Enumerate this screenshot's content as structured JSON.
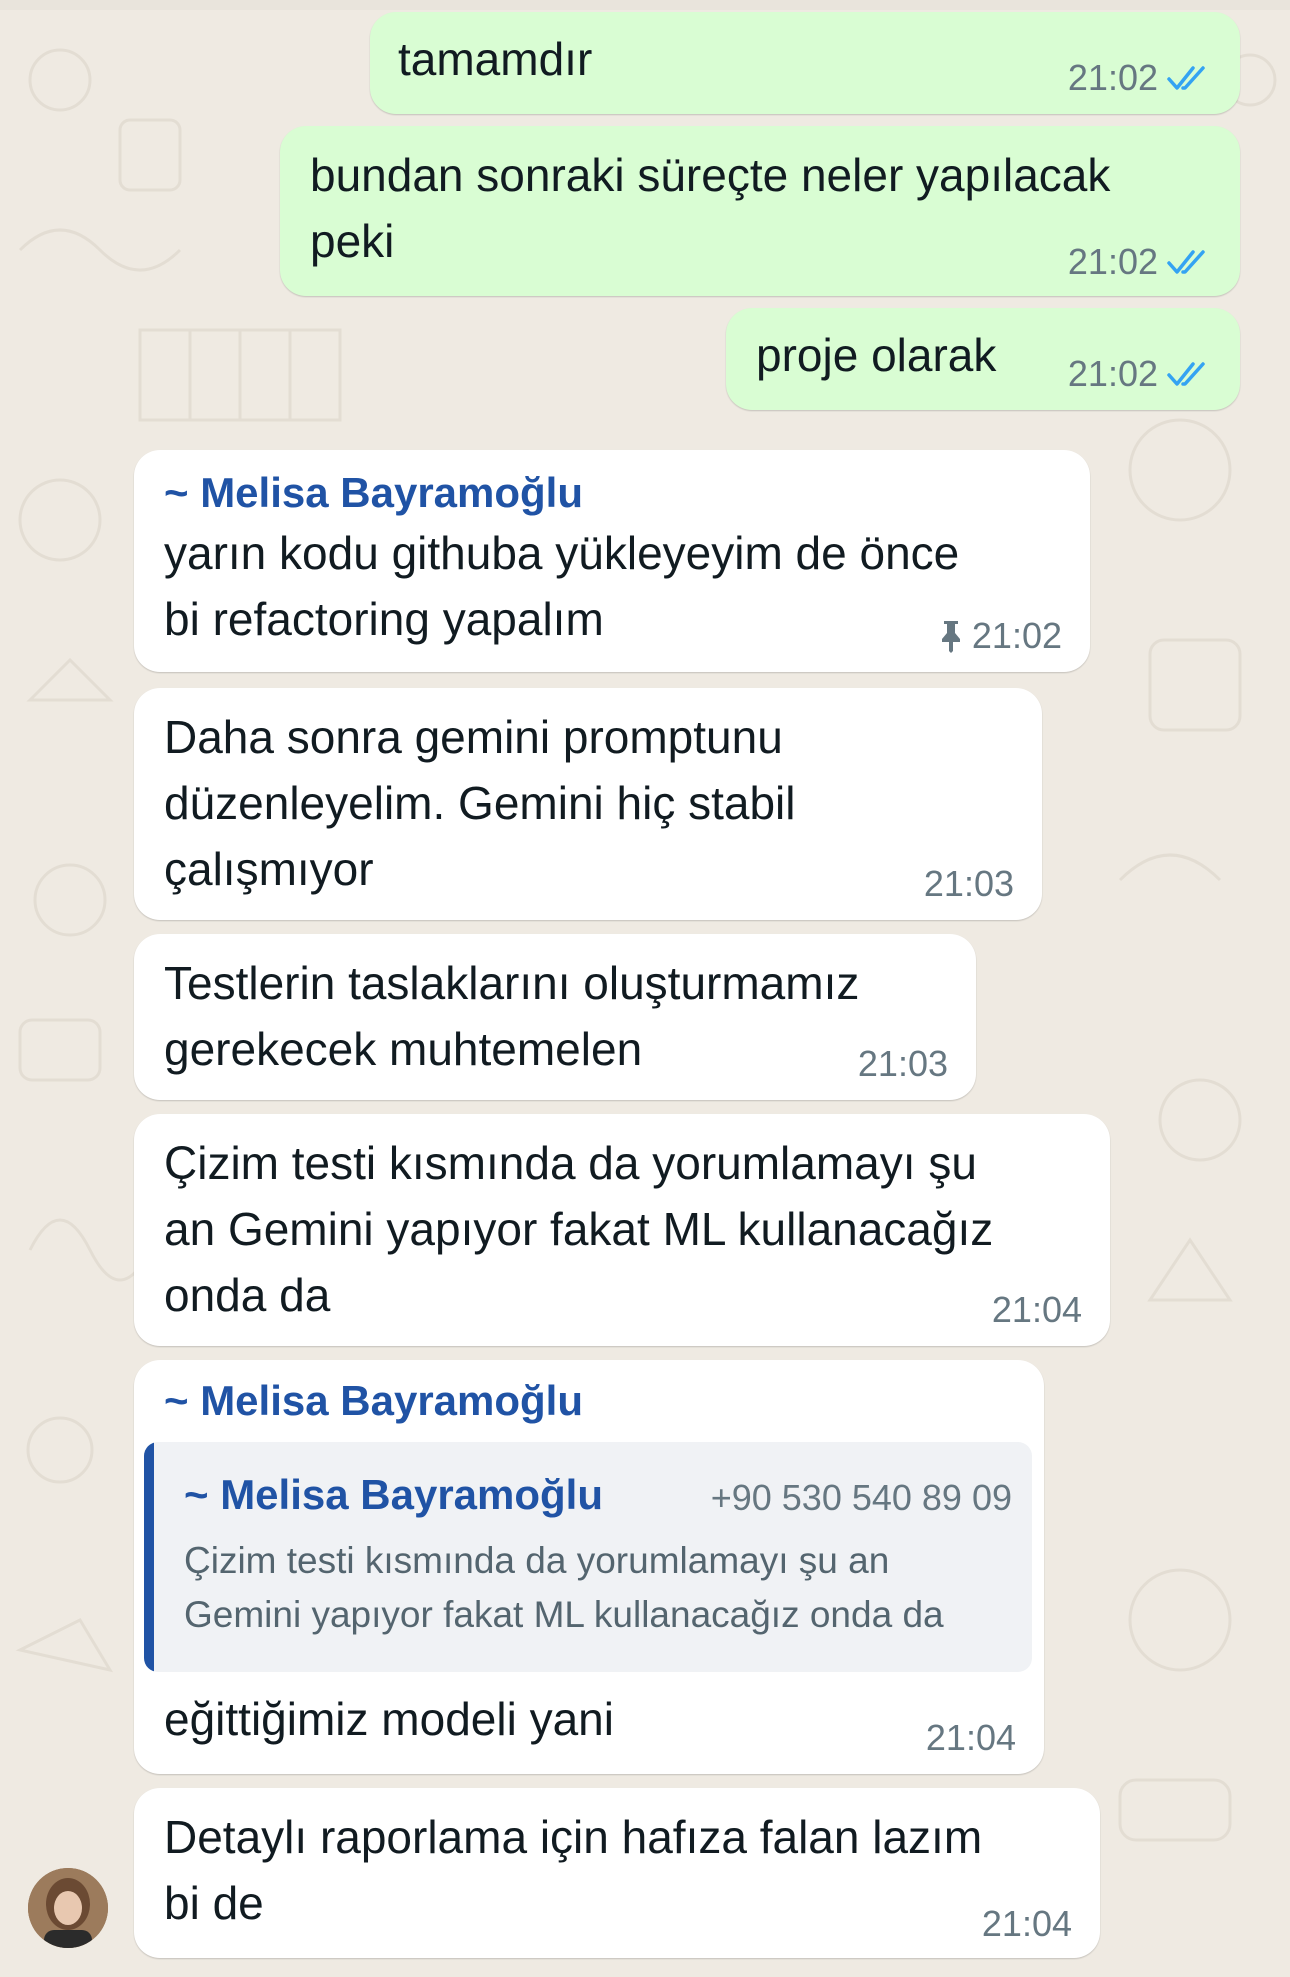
{
  "colors": {
    "chat_background": "#efeae2",
    "outgoing_bubble": "#d9fdd3",
    "incoming_bubble": "#ffffff",
    "sender_name": "#2053a5",
    "read_ticks": "#34a3f2",
    "timestamp": "#667781"
  },
  "messages": [
    {
      "text_lines": [
        "tamamdır"
      ],
      "time": "21:02",
      "status_icon": "double-check-read-icon"
    },
    {
      "text_lines": [
        "bundan sonraki süreçte neler yapılacak",
        "peki"
      ],
      "time": "21:02",
      "status_icon": "double-check-read-icon"
    },
    {
      "text_lines": [
        "proje olarak"
      ],
      "time": "21:02",
      "status_icon": "double-check-read-icon"
    },
    {
      "sender": "~ Melisa Bayramoğlu",
      "text_lines": [
        "yarın kodu githuba yükleyeyim de önce",
        "bi refactoring yapalım"
      ],
      "time": "21:02",
      "pinned": true,
      "pin_icon": "pin-icon"
    },
    {
      "text_lines": [
        "Daha sonra gemini promptunu",
        "düzenleyelim. Gemini hiç stabil",
        "çalışmıyor"
      ],
      "time": "21:03"
    },
    {
      "text_lines": [
        "Testlerin taslaklarını oluşturmamız",
        "gerekecek muhtemelen"
      ],
      "time": "21:03"
    },
    {
      "text_lines": [
        "Çizim testi kısmında da yorumlamayı şu",
        "an Gemini yapıyor fakat ML kullanacağız",
        "onda da"
      ],
      "time": "21:04"
    },
    {
      "sender": "~ Melisa Bayramoğlu",
      "quoted": {
        "sender": "~ Melisa Bayramoğlu",
        "phone": "+90 530 540 89 09",
        "text_lines": [
          "Çizim testi kısmında da yorumlamayı şu an",
          "Gemini yapıyor fakat ML kullanacağız onda da"
        ]
      },
      "text_lines": [
        "eğittiğimiz modeli yani"
      ],
      "time": "21:04"
    },
    {
      "text_lines": [
        "Detaylı raporlama için hafıza falan lazım",
        "bi de"
      ],
      "time": "21:04",
      "avatar": "avatar"
    }
  ]
}
